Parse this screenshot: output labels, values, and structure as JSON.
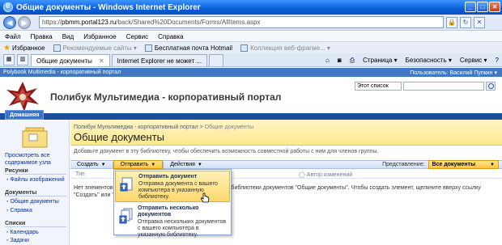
{
  "window": {
    "title": "Общие документы - Windows Internet Explorer"
  },
  "address": {
    "url_prefix": "https://",
    "url_domain": "pbmm.portal123.ru",
    "url_path": "/back/Shared%20Documents/Forms/AllItems.aspx"
  },
  "menubar": [
    "Файл",
    "Правка",
    "Вид",
    "Избранное",
    "Сервис",
    "Справка"
  ],
  "favbar": {
    "favorites": "Избранное",
    "items": [
      {
        "label": "Рекомендуемые сайты ▾",
        "dim": true
      },
      {
        "label": "Бесплатная почта Hotmail",
        "dim": false
      },
      {
        "label": "Коллекция веб-фрагме... ▾",
        "dim": true
      }
    ]
  },
  "tabs": [
    {
      "label": "Общие документы",
      "active": true
    },
    {
      "label": "Internet Explorer не может ...",
      "active": false
    }
  ],
  "commandbar": [
    "Страница ▾",
    "Безопасность ▾",
    "Сервис ▾",
    "?"
  ],
  "sp": {
    "global_left": "Polybook Multimedia - корпоративный портал",
    "user": "Пользователь: Василий Пупкин ▾",
    "site_title": "Полибук Мультимедиа - корпоративный портал",
    "search_scope": "Этот список",
    "home_tab": "Домашняя",
    "breadcrumb_site": "Полибук Мультимедиа - корпоративный портал",
    "breadcrumb_sep": " > ",
    "breadcrumb_current": "Общие документы",
    "page_title": "Общие документы",
    "description": "Добавьте документ в эту библиотеку, чтобы обеспечить возможность совместной работы с ним для членов группы.",
    "view_all": "Просмотреть все содержимое узла",
    "quicklaunch": {
      "pictures_head": "Рисунки",
      "pictures_items": [
        "Файлы изображений"
      ],
      "documents_head": "Документы",
      "documents_items": [
        "Общие документы",
        "Справка"
      ],
      "lists_head": "Списки",
      "lists_items": [
        "Календарь",
        "Задачи"
      ]
    },
    "toolbar": {
      "create": "Создать",
      "send": "Отправить",
      "actions": "Действия",
      "view_label": "Представление:",
      "view_value": "Все документы"
    },
    "columns": {
      "type": "Тип",
      "author": "Автор изменений"
    },
    "empty_line1": "Нет элементов,                                                                          библиотеки документов \"Общие документы\". Чтобы создать элемент, щелкните вверху ссылку",
    "empty_line2": "\"Создать\" или \""
  },
  "send_menu": {
    "items": [
      {
        "title": "Отправить документ",
        "desc": [
          "Отправка документа с вашего",
          "компьютера в указанную",
          "библиотеку."
        ]
      },
      {
        "title": "Отправить несколько документов",
        "desc": [
          "Отправка нескольких документов",
          "с вашего компьютера в",
          "указанную библиотеку."
        ]
      }
    ]
  }
}
